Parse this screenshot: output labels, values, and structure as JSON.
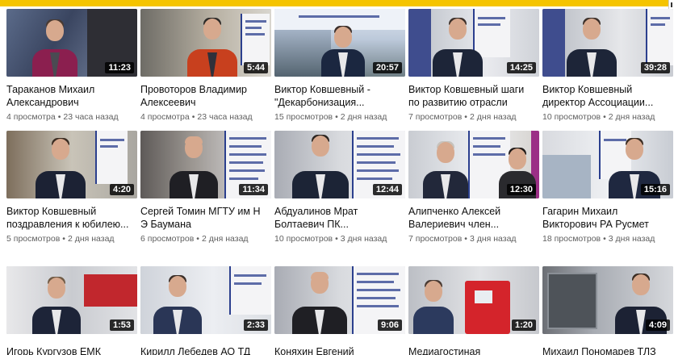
{
  "rows": [
    [
      {
        "title": "Тараканов Михаил Александрович",
        "views": "4 просмотра",
        "age": "23 часа назад",
        "duration": "11:23"
      },
      {
        "title": "Провоторов Владимир Алексеевич",
        "views": "4 просмотра",
        "age": "23 часа назад",
        "duration": "5:44"
      },
      {
        "title": "Виктор Ковшевный - \"Декарбонизация...",
        "views": "15 просмотров",
        "age": "2 дня назад",
        "duration": "20:57"
      },
      {
        "title": "Виктор Ковшевный шаги по развитию отрасли",
        "views": "7 просмотров",
        "age": "2 дня назад",
        "duration": "14:25"
      },
      {
        "title": "Виктор Ковшевный директор Ассоциации...",
        "views": "10 просмотров",
        "age": "2 дня назад",
        "duration": "39:28"
      }
    ],
    [
      {
        "title": "Виктор Ковшевный поздравления к юбилею...",
        "views": "5 просмотров",
        "age": "2 дня назад",
        "duration": "4:20"
      },
      {
        "title": "Сергей Томин МГТУ им Н Э Баумана",
        "views": "6 просмотров",
        "age": "2 дня назад",
        "duration": "11:34"
      },
      {
        "title": "Абдуалинов Мрат Болтаевич ПК...",
        "views": "10 просмотров",
        "age": "3 дня назад",
        "duration": "12:44"
      },
      {
        "title": "Алипченко Алексей Валериевич член...",
        "views": "7 просмотров",
        "age": "3 дня назад",
        "duration": "12:30"
      },
      {
        "title": "Гагарин Михаил Викторович РА Русмет",
        "views": "18 просмотров",
        "age": "3 дня назад",
        "duration": "15:16"
      }
    ],
    [
      {
        "title": "Игорь Кургузов ЕМК",
        "views": "",
        "age": "",
        "duration": "1:53"
      },
      {
        "title": "Кирилл Лебедев АО ТД",
        "views": "",
        "age": "",
        "duration": "2:33"
      },
      {
        "title": "Коняхин Евгений",
        "views": "",
        "age": "",
        "duration": "9:06"
      },
      {
        "title": "Медиагостиная",
        "views": "",
        "age": "",
        "duration": "1:20"
      },
      {
        "title": "Михаил Пономарев ТЛЗ",
        "views": "",
        "age": "",
        "duration": "4:09"
      }
    ]
  ],
  "colors": {
    "accent": "#f5c400",
    "title_text": "#0f0f0f",
    "meta_text": "#606060",
    "badge_bg": "#000000"
  },
  "icons": {
    "window_corner": "scrollbar-icon"
  }
}
